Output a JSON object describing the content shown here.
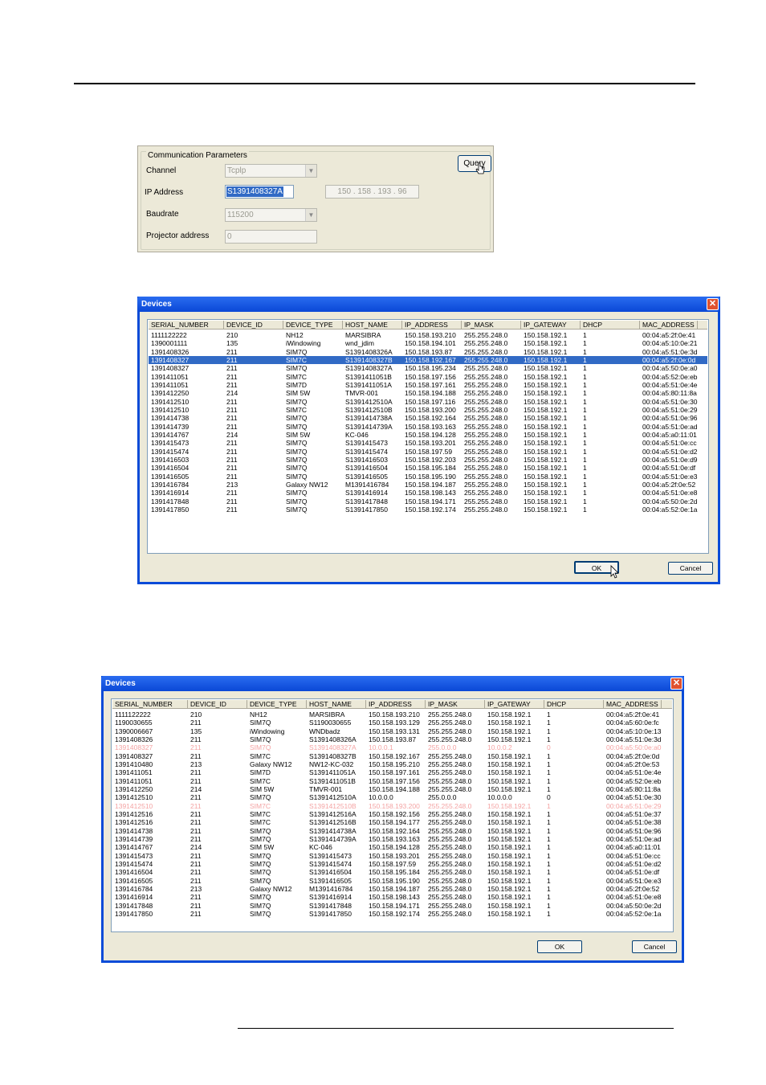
{
  "comm": {
    "legend": "Communication Parameters",
    "channel_label": "Channel",
    "channel_value": "Tcplp",
    "ip_label": "IP Address",
    "ip_value": "S1391408327A",
    "ip_resolved": "150 . 158 . 193 . 96",
    "baud_label": "Baudrate",
    "baud_value": "115200",
    "proj_label": "Projector address",
    "proj_value": "0",
    "query_label": "Query"
  },
  "columns": [
    "SERIAL_NUMBER",
    "DEVICE_ID",
    "DEVICE_TYPE",
    "HOST_NAME",
    "IP_ADDRESS",
    "IP_MASK",
    "IP_GATEWAY",
    "DHCP",
    "MAC_ADDRESS"
  ],
  "dialog1": {
    "title": "Devices",
    "ok": "OK",
    "cancel": "Cancel",
    "selected_index": 3,
    "rows": [
      [
        "1111122222",
        "210",
        "NH12",
        "MARSIBRA",
        "150.158.193.210",
        "255.255.248.0",
        "150.158.192.1",
        "1",
        "00:04:a5:2f:0e:41"
      ],
      [
        "1390001111",
        "135",
        "iWindowing",
        "wnd_jdim",
        "150.158.194.101",
        "255.255.248.0",
        "150.158.192.1",
        "1",
        "00:04:a5:10:0e:21"
      ],
      [
        "1391408326",
        "211",
        "SIM7Q",
        "S1391408326A",
        "150.158.193.87",
        "255.255.248.0",
        "150.158.192.1",
        "1",
        "00:04:a5:51:0e:3d"
      ],
      [
        "1391408327",
        "211",
        "SIM7C",
        "S1391408327B",
        "150.158.192.167",
        "255.255.248.0",
        "150.158.192.1",
        "1",
        "00:04:a5:2f:0e:0d"
      ],
      [
        "1391408327",
        "211",
        "SIM7Q",
        "S1391408327A",
        "150.158.195.234",
        "255.255.248.0",
        "150.158.192.1",
        "1",
        "00:04:a5:50:0e:a0"
      ],
      [
        "1391411051",
        "211",
        "SIM7C",
        "S1391411051B",
        "150.158.197.156",
        "255.255.248.0",
        "150.158.192.1",
        "1",
        "00:04:a5:52:0e:eb"
      ],
      [
        "1391411051",
        "211",
        "SIM7D",
        "S1391411051A",
        "150.158.197.161",
        "255.255.248.0",
        "150.158.192.1",
        "1",
        "00:04:a5:51:0e:4e"
      ],
      [
        "1391412250",
        "214",
        "SIM 5W",
        "TMVR-001",
        "150.158.194.188",
        "255.255.248.0",
        "150.158.192.1",
        "1",
        "00:04:a5:80:11:8a"
      ],
      [
        "1391412510",
        "211",
        "SIM7Q",
        "S1391412510A",
        "150.158.197.116",
        "255.255.248.0",
        "150.158.192.1",
        "1",
        "00:04:a5:51:0e:30"
      ],
      [
        "1391412510",
        "211",
        "SIM7C",
        "S1391412510B",
        "150.158.193.200",
        "255.255.248.0",
        "150.158.192.1",
        "1",
        "00:04:a5:51:0e:29"
      ],
      [
        "1391414738",
        "211",
        "SIM7Q",
        "S1391414738A",
        "150.158.192.164",
        "255.255.248.0",
        "150.158.192.1",
        "1",
        "00:04:a5:51:0e:96"
      ],
      [
        "1391414739",
        "211",
        "SIM7Q",
        "S1391414739A",
        "150.158.193.163",
        "255.255.248.0",
        "150.158.192.1",
        "1",
        "00:04:a5:51:0e:ad"
      ],
      [
        "1391414767",
        "214",
        "SIM 5W",
        "KC-046",
        "150.158.194.128",
        "255.255.248.0",
        "150.158.192.1",
        "1",
        "00:04:a5:a0:11:01"
      ],
      [
        "1391415473",
        "211",
        "SIM7Q",
        "S1391415473",
        "150.158.193.201",
        "255.255.248.0",
        "150.158.192.1",
        "1",
        "00:04:a5:51:0e:cc"
      ],
      [
        "1391415474",
        "211",
        "SIM7Q",
        "S1391415474",
        "150.158.197.59",
        "255.255.248.0",
        "150.158.192.1",
        "1",
        "00:04:a5:51:0e:d2"
      ],
      [
        "1391416503",
        "211",
        "SIM7Q",
        "S1391416503",
        "150.158.192.203",
        "255.255.248.0",
        "150.158.192.1",
        "1",
        "00:04:a5:51:0e:d9"
      ],
      [
        "1391416504",
        "211",
        "SIM7Q",
        "S1391416504",
        "150.158.195.184",
        "255.255.248.0",
        "150.158.192.1",
        "1",
        "00:04:a5:51:0e:df"
      ],
      [
        "1391416505",
        "211",
        "SIM7Q",
        "S1391416505",
        "150.158.195.190",
        "255.255.248.0",
        "150.158.192.1",
        "1",
        "00:04:a5:51:0e:e3"
      ],
      [
        "1391416784",
        "213",
        "Galaxy NW12",
        "M1391416784",
        "150.158.194.187",
        "255.255.248.0",
        "150.158.192.1",
        "1",
        "00:04:a5:2f:0e:52"
      ],
      [
        "1391416914",
        "211",
        "SIM7Q",
        "S1391416914",
        "150.158.198.143",
        "255.255.248.0",
        "150.158.192.1",
        "1",
        "00:04:a5:51:0e:e8"
      ],
      [
        "1391417848",
        "211",
        "SIM7Q",
        "S1391417848",
        "150.158.194.171",
        "255.255.248.0",
        "150.158.192.1",
        "1",
        "00:04:a5:50:0e:2d"
      ],
      [
        "1391417850",
        "211",
        "SIM7Q",
        "S1391417850",
        "150.158.192.174",
        "255.255.248.0",
        "150.158.192.1",
        "1",
        "00:04:a5:52:0e:1a"
      ]
    ]
  },
  "dialog2": {
    "title": "Devices",
    "ok": "OK",
    "cancel": "Cancel",
    "dim_indices": [
      4,
      11
    ],
    "rows": [
      [
        "1111122222",
        "210",
        "NH12",
        "MARSIBRA",
        "150.158.193.210",
        "255.255.248.0",
        "150.158.192.1",
        "1",
        "00:04:a5:2f:0e:41"
      ],
      [
        "1190030655",
        "211",
        "SIM7Q",
        "S1190030655",
        "150.158.193.129",
        "255.255.248.0",
        "150.158.192.1",
        "1",
        "00:04:a5:60:0e:fc"
      ],
      [
        "1390006667",
        "135",
        "iWindowing",
        "WNDbadz",
        "150.158.193.131",
        "255.255.248.0",
        "150.158.192.1",
        "1",
        "00:04:a5:10:0e:13"
      ],
      [
        "1391408326",
        "211",
        "SIM7Q",
        "S1391408326A",
        "150.158.193.87",
        "255.255.248.0",
        "150.158.192.1",
        "1",
        "00:04:a5:51:0e:3d"
      ],
      [
        "1391408327",
        "211",
        "SIM7Q",
        "S1391408327A",
        "10.0.0.1",
        "255.0.0.0",
        "10.0.0.2",
        "0",
        "00:04:a5:50:0e:a0"
      ],
      [
        "1391408327",
        "211",
        "SIM7C",
        "S1391408327B",
        "150.158.192.167",
        "255.255.248.0",
        "150.158.192.1",
        "1",
        "00:04:a5:2f:0e:0d"
      ],
      [
        "1391410480",
        "213",
        "Galaxy NW12",
        "NW12-KC-032",
        "150.158.195.210",
        "255.255.248.0",
        "150.158.192.1",
        "1",
        "00:04:a5:2f:0e:53"
      ],
      [
        "1391411051",
        "211",
        "SIM7D",
        "S1391411051A",
        "150.158.197.161",
        "255.255.248.0",
        "150.158.192.1",
        "1",
        "00:04:a5:51:0e:4e"
      ],
      [
        "1391411051",
        "211",
        "SIM7C",
        "S1391411051B",
        "150.158.197.156",
        "255.255.248.0",
        "150.158.192.1",
        "1",
        "00:04:a5:52:0e:eb"
      ],
      [
        "1391412250",
        "214",
        "SIM 5W",
        "TMVR-001",
        "150.158.194.188",
        "255.255.248.0",
        "150.158.192.1",
        "1",
        "00:04:a5:80:11:8a"
      ],
      [
        "1391412510",
        "211",
        "SIM7Q",
        "S1391412510A",
        "10.0.0.0",
        "255.0.0.0",
        "10.0.0.0",
        "0",
        "00:04:a5:51:0e:30"
      ],
      [
        "1391412510",
        "211",
        "SIM7C",
        "S1391412510B",
        "150.158.193.200",
        "255.255.248.0",
        "150.158.192.1",
        "1",
        "00:04:a5:51:0e:29"
      ],
      [
        "1391412516",
        "211",
        "SIM7C",
        "S1391412516A",
        "150.158.192.156",
        "255.255.248.0",
        "150.158.192.1",
        "1",
        "00:04:a5:51:0e:37"
      ],
      [
        "1391412516",
        "211",
        "SIM7C",
        "S1391412516B",
        "150.158.194.177",
        "255.255.248.0",
        "150.158.192.1",
        "1",
        "00:04:a5:51:0e:38"
      ],
      [
        "1391414738",
        "211",
        "SIM7Q",
        "S1391414738A",
        "150.158.192.164",
        "255.255.248.0",
        "150.158.192.1",
        "1",
        "00:04:a5:51:0e:96"
      ],
      [
        "1391414739",
        "211",
        "SIM7Q",
        "S1391414739A",
        "150.158.193.163",
        "255.255.248.0",
        "150.158.192.1",
        "1",
        "00:04:a5:51:0e:ad"
      ],
      [
        "1391414767",
        "214",
        "SIM 5W",
        "KC-046",
        "150.158.194.128",
        "255.255.248.0",
        "150.158.192.1",
        "1",
        "00:04:a5:a0:11:01"
      ],
      [
        "1391415473",
        "211",
        "SIM7Q",
        "S1391415473",
        "150.158.193.201",
        "255.255.248.0",
        "150.158.192.1",
        "1",
        "00:04:a5:51:0e:cc"
      ],
      [
        "1391415474",
        "211",
        "SIM7Q",
        "S1391415474",
        "150.158.197.59",
        "255.255.248.0",
        "150.158.192.1",
        "1",
        "00:04:a5:51:0e:d2"
      ],
      [
        "1391416504",
        "211",
        "SIM7Q",
        "S1391416504",
        "150.158.195.184",
        "255.255.248.0",
        "150.158.192.1",
        "1",
        "00:04:a5:51:0e:df"
      ],
      [
        "1391416505",
        "211",
        "SIM7Q",
        "S1391416505",
        "150.158.195.190",
        "255.255.248.0",
        "150.158.192.1",
        "1",
        "00:04:a5:51:0e:e3"
      ],
      [
        "1391416784",
        "213",
        "Galaxy NW12",
        "M1391416784",
        "150.158.194.187",
        "255.255.248.0",
        "150.158.192.1",
        "1",
        "00:04:a5:2f:0e:52"
      ],
      [
        "1391416914",
        "211",
        "SIM7Q",
        "S1391416914",
        "150.158.198.143",
        "255.255.248.0",
        "150.158.192.1",
        "1",
        "00:04:a5:51:0e:e8"
      ],
      [
        "1391417848",
        "211",
        "SIM7Q",
        "S1391417848",
        "150.158.194.171",
        "255.255.248.0",
        "150.158.192.1",
        "1",
        "00:04:a5:50:0e:2d"
      ],
      [
        "1391417850",
        "211",
        "SIM7Q",
        "S1391417850",
        "150.158.192.174",
        "255.255.248.0",
        "150.158.192.1",
        "1",
        "00:04:a5:52:0e:1a"
      ]
    ]
  }
}
